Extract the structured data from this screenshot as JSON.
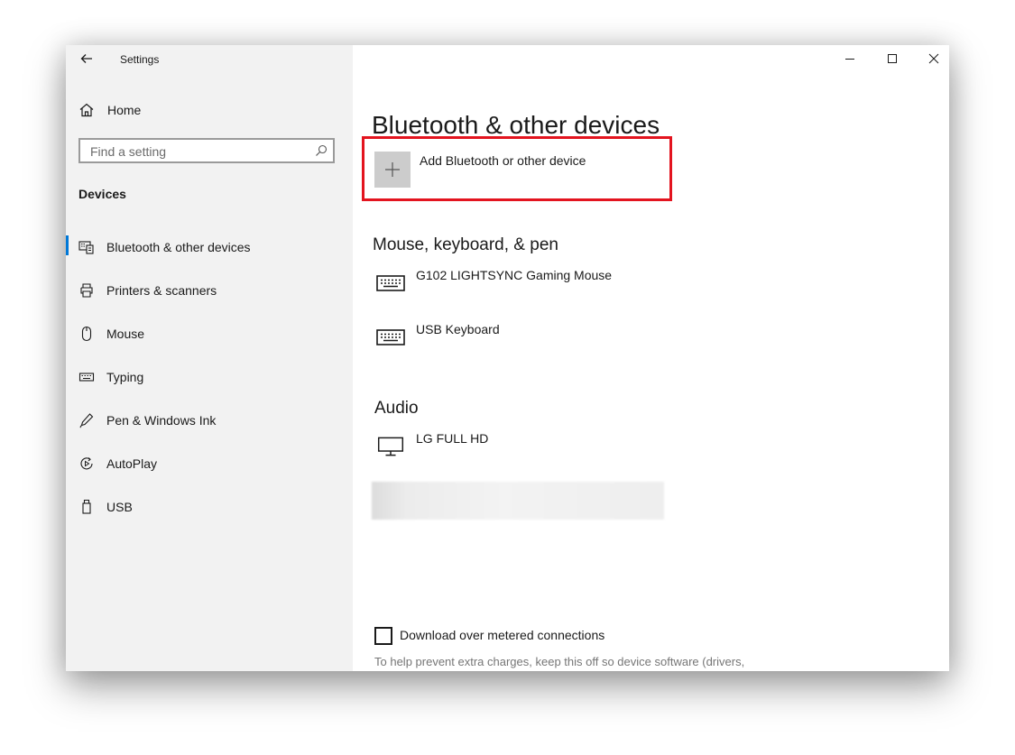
{
  "window": {
    "app_title": "Settings"
  },
  "sidebar": {
    "home_label": "Home",
    "search_placeholder": "Find a setting",
    "section_heading": "Devices",
    "items": [
      {
        "label": "Bluetooth & other devices",
        "icon": "bluetooth-devices-icon",
        "selected": true
      },
      {
        "label": "Printers & scanners",
        "icon": "printer-icon",
        "selected": false
      },
      {
        "label": "Mouse",
        "icon": "mouse-icon",
        "selected": false
      },
      {
        "label": "Typing",
        "icon": "keyboard-icon",
        "selected": false
      },
      {
        "label": "Pen & Windows Ink",
        "icon": "pen-icon",
        "selected": false
      },
      {
        "label": "AutoPlay",
        "icon": "autoplay-icon",
        "selected": false
      },
      {
        "label": "USB",
        "icon": "usb-icon",
        "selected": false
      }
    ]
  },
  "main": {
    "title": "Bluetooth & other devices",
    "add_device_label": "Add Bluetooth or other device",
    "groups": [
      {
        "title": "Mouse, keyboard, & pen",
        "devices": [
          {
            "name": "G102 LIGHTSYNC Gaming Mouse",
            "icon": "keyboard-device-icon"
          },
          {
            "name": "USB Keyboard",
            "icon": "keyboard-device-icon"
          }
        ]
      },
      {
        "title": "Audio",
        "devices": [
          {
            "name": "LG FULL HD",
            "icon": "monitor-icon"
          }
        ]
      }
    ],
    "metered_label": "Download over metered connections",
    "metered_checked": false,
    "metered_help": "To help prevent extra charges, keep this off so device software (drivers,"
  },
  "colors": {
    "accent": "#0078d7",
    "highlight_border": "#e3141f",
    "sidebar_bg": "#f2f2f2",
    "plus_tile": "#cccccc"
  }
}
